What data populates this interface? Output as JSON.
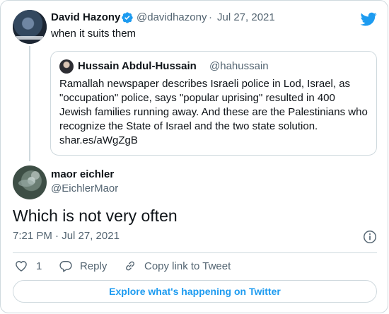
{
  "parent_tweet": {
    "author_name": "David Hazony",
    "handle": "@davidhazony",
    "separator": "·",
    "date": "Jul 27, 2021",
    "text": "when it suits them",
    "verified": true
  },
  "quoted_tweet": {
    "author_name": "Hussain Abdul-Hussain",
    "handle": "@hahussain",
    "text_lines": [
      "Ramallah newspaper describes Israeli police in Lod, Israel, as",
      "\"occupation\" police, says \"popular uprising\" resulted in 400",
      "Jewish families running away. And these are the Palestinians who",
      "recognize the State of Israel and the two state solution.",
      "shar.es/aWgZgB"
    ]
  },
  "reply_tweet": {
    "author_name": "maor eichler",
    "handle": "@EichlerMaor",
    "text": "Which is not very often",
    "timestamp": "7:21 PM · Jul 27, 2021"
  },
  "actions": {
    "like_count": "1",
    "reply_label": "Reply",
    "copy_link_label": "Copy link to Tweet"
  },
  "explore_button": "Explore what's happening on Twitter",
  "colors": {
    "accent": "#1d9bf0",
    "secondary_text": "#536471",
    "border": "#cfd9de"
  },
  "icons": {
    "verified": "verified-badge-icon",
    "logo": "twitter-bird-icon",
    "info": "info-icon",
    "like": "heart-icon",
    "reply": "speech-bubble-icon",
    "copy_link": "link-icon"
  }
}
